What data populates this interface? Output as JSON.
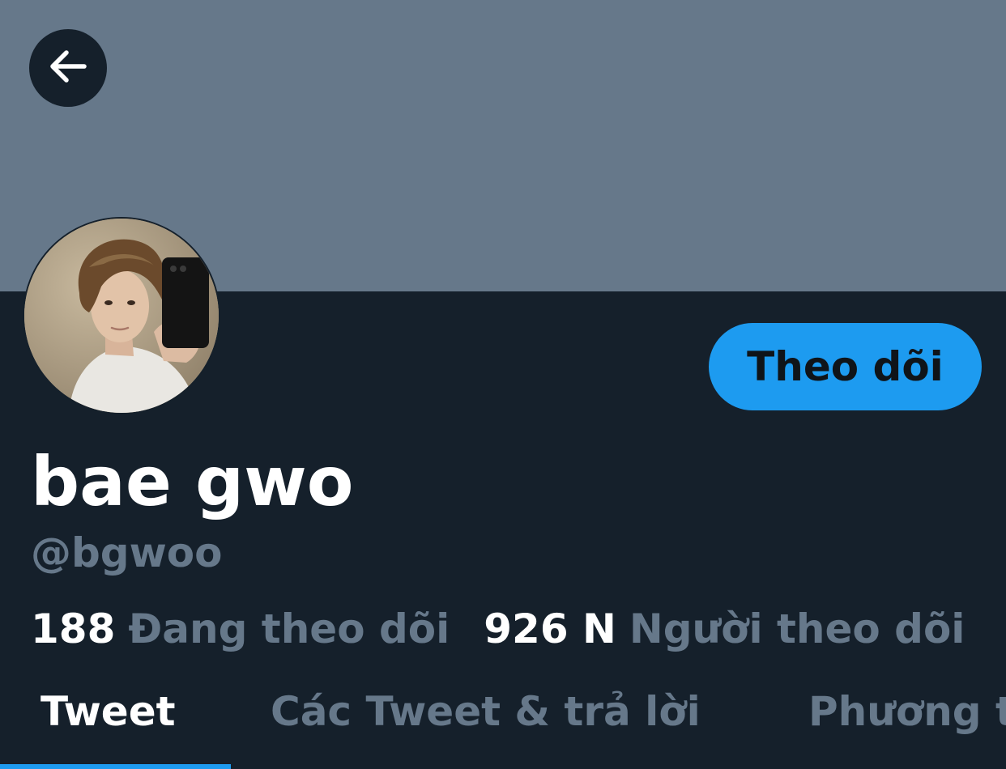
{
  "colors": {
    "banner": "#66788a",
    "background": "#15202b",
    "accent": "#1d9bf0",
    "muted_text": "#66788a",
    "primary_text": "#ffffff"
  },
  "header": {
    "back_icon": "arrow-left-icon"
  },
  "profile": {
    "display_name": "bae gwo",
    "handle": "@bgwoo",
    "follow_label": "Theo dõi",
    "following_count": "188",
    "following_label": "Đang theo dõi",
    "followers_count": "926 N",
    "followers_label": "Người theo dõi"
  },
  "tabs": [
    {
      "label": "Tweet",
      "active": true
    },
    {
      "label": "Các Tweet & trả lời",
      "active": false
    },
    {
      "label": "Phương tiện",
      "active": false
    }
  ]
}
